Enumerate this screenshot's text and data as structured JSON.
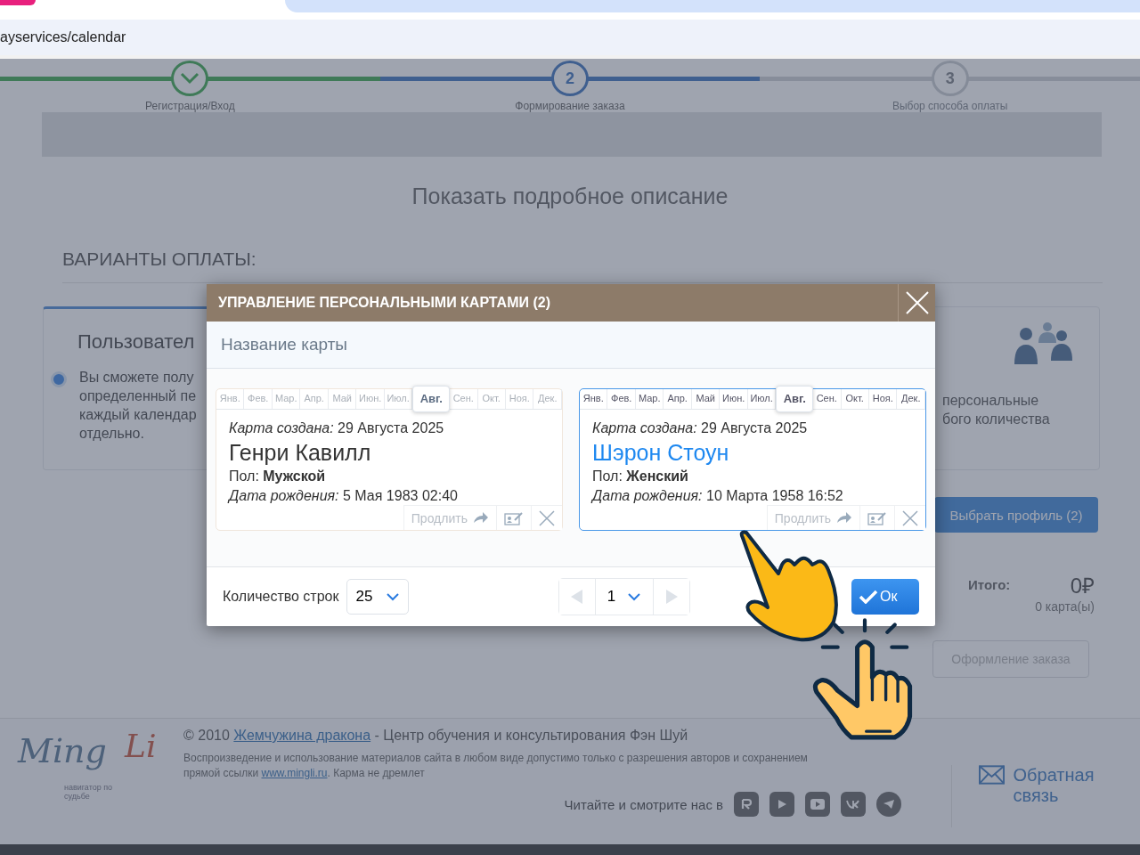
{
  "browser": {
    "url": "ayservices/calendar"
  },
  "steps": [
    {
      "kind": "done",
      "label": "Регистрация/Вход"
    },
    {
      "kind": "current",
      "number": "2",
      "label": "Формирование заказа"
    },
    {
      "kind": "pending",
      "number": "3",
      "label": "Выбор способа оплаты"
    }
  ],
  "page": {
    "details_link": "Показать подробное описание",
    "section_title": "ВАРИАНТЫ ОПЛАТЫ:",
    "left_option": {
      "title": "Пользовател",
      "selected": true,
      "lines": [
        "Вы сможете полу",
        "определенный пе",
        "каждый календар",
        "отдельно."
      ]
    },
    "right_option": {
      "lines": [
        "персональные",
        "бого количества"
      ]
    },
    "choose_button": "Выбрать профиль (2)",
    "total_label": "Итого:",
    "total_value": "0₽",
    "total_count": "0 карта(ы)",
    "checkout_button": "Оформление заказа"
  },
  "modal": {
    "title": "УПРАВЛЕНИЕ ПЕРСОНАЛЬНЫМИ КАРТАМИ (2)",
    "search": {
      "placeholder": "Название карты"
    },
    "cards": [
      {
        "selected": false,
        "months": [
          {
            "label": "Янв.",
            "selected": false
          },
          {
            "label": "Фев.",
            "selected": false
          },
          {
            "label": "Мар.",
            "selected": false
          },
          {
            "label": "Апр.",
            "selected": false
          },
          {
            "label": "Май",
            "selected": false
          },
          {
            "label": "Июн.",
            "selected": false
          },
          {
            "label": "Июл.",
            "selected": false
          },
          {
            "label": "Авг.",
            "selected": true
          },
          {
            "label": "Сен.",
            "selected": false
          },
          {
            "label": "Окт.",
            "selected": false
          },
          {
            "label": "Ноя.",
            "selected": false
          },
          {
            "label": "Дек.",
            "selected": false
          }
        ],
        "created_label": "Карта создана:",
        "created": "29 Августа 2025",
        "name": "Генри Кавилл",
        "gender_label": "Пол:",
        "gender": "Мужской",
        "birth_label": "Дата рождения:",
        "birth": "5 Мая 1983 02:40",
        "extend": "Продлить"
      },
      {
        "selected": true,
        "months": [
          {
            "label": "Янв.",
            "selected": false
          },
          {
            "label": "Фев.",
            "selected": false
          },
          {
            "label": "Мар.",
            "selected": false
          },
          {
            "label": "Апр.",
            "selected": false
          },
          {
            "label": "Май",
            "selected": false
          },
          {
            "label": "Июн.",
            "selected": false
          },
          {
            "label": "Июл.",
            "selected": false
          },
          {
            "label": "Авг.",
            "selected": true
          },
          {
            "label": "Сен.",
            "selected": false
          },
          {
            "label": "Окт.",
            "selected": false
          },
          {
            "label": "Ноя.",
            "selected": false
          },
          {
            "label": "Дек.",
            "selected": false
          }
        ],
        "created_label": "Карта создана:",
        "created": "29 Августа 2025",
        "name": "Шэрон Стоун",
        "gender_label": "Пол:",
        "gender": "Женский",
        "birth_label": "Дата рождения:",
        "birth": "10 Марта 1958 16:52",
        "extend": "Продлить"
      }
    ],
    "rows_label": "Количество строк",
    "rows_value": "25",
    "page_value": "1",
    "ok": "Ок"
  },
  "footer": {
    "logo_main": "Ming",
    "logo_accent": "Li",
    "logo_tagline": "навигатор по судьбе",
    "copyright_before": "© 2010",
    "copyright_link": "Жемчужина дракона",
    "copyright_after": "- Центр обучения и консультирования Фэн Шуй",
    "notice_before": "Воспроизведение и использование материалов сайта в любом виде допустимо только с разрешения авторов и сохранением прямой ссылки",
    "notice_link": "www.mingli.ru",
    "notice_after": ". Карма не дремлет",
    "social_label": "Читайте и смотрите нас в",
    "feedback": "Обратная связь"
  }
}
